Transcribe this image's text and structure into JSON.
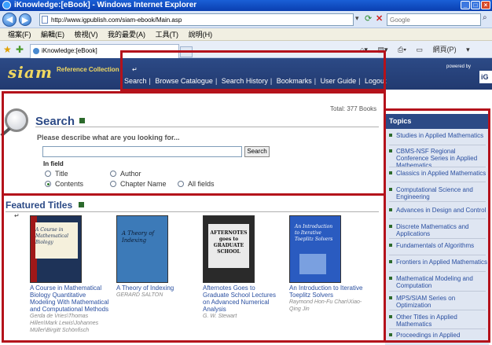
{
  "browser": {
    "title": "iKnowledge:[eBook] - Windows Internet Explorer",
    "url": "http://www.igpublish.com/siam-ebook/Main.asp",
    "search_placeholder": "Google",
    "menu": [
      "檔案(F)",
      "編輯(E)",
      "檢視(V)",
      "我的最愛(A)",
      "工具(T)",
      "說明(H)"
    ],
    "tab_label": "iKnowledge:[eBook]",
    "page_menu_label": "網頁(P)"
  },
  "header": {
    "logo": "siam",
    "logo_sub": "Reference Collection",
    "powered_by": "powered by",
    "powered_logo": "iG",
    "nav": [
      "Search",
      "Browse Catalogue",
      "Search History",
      "Bookmarks",
      "User Guide",
      "Logout"
    ]
  },
  "search": {
    "total": "Total: 377 Books",
    "title": "Search",
    "describe": "Please describe what are you looking for...",
    "button": "Search",
    "in_field": "In field",
    "fields": [
      {
        "label": "Title",
        "selected": false
      },
      {
        "label": "Author",
        "selected": false
      },
      {
        "label": "Contents",
        "selected": true
      },
      {
        "label": "Chapter Name",
        "selected": false
      },
      {
        "label": "All fields",
        "selected": false
      }
    ]
  },
  "featured": {
    "title": "Featured Titles",
    "books": [
      {
        "title": "A Course in Mathematical Biology Quantitative Modeling With Mathematical and Computational Methods",
        "author": "Gerda de Vries\\Thomas Hillen\\Mark Lewis\\Johannes Müller\\Birgitt Schönfisch",
        "cover_text": "A Course in Mathematical Biology",
        "cover_color": "#1e3358"
      },
      {
        "title": "A Theory of Indexing",
        "author": "GERARD SALTON",
        "cover_text": "A Theory of Indexing",
        "cover_color": "#3c7ab8"
      },
      {
        "title": "Afternotes Goes to Graduate School Lectures on Advanced Numerical Analysis",
        "author": "G. W. Stewart",
        "cover_text": "AFTERNOTES goes to GRADUATE SCHOOL",
        "cover_color": "#2a2a2a"
      },
      {
        "title": "An Introduction to Iterative Toeplitz Solvers",
        "author": "Raymond Hon-Fu Chan\\Xiao-Qing Jin",
        "cover_text": "An Introduction to Iterative Toeplitz Solvers",
        "cover_color": "#2a5bc0"
      }
    ]
  },
  "topics": {
    "title": "Topics",
    "items": [
      "Studies in Applied Mathematics",
      "CBMS-NSF Regional Conference Series in Applied Mathematics",
      "Classics in Applied Mathematics",
      "Computational Science and Engineering",
      "Advances in Design and Control",
      "Discrete Mathematics and Applications",
      "Fundamentals of Algorithms",
      "Frontiers in Applied Mathematics",
      "Mathematical Modeling and Computation",
      "MPS/SIAM Series on Optimization",
      "Other Titles in Applied Mathematics",
      "Proceedings in Applied"
    ]
  }
}
